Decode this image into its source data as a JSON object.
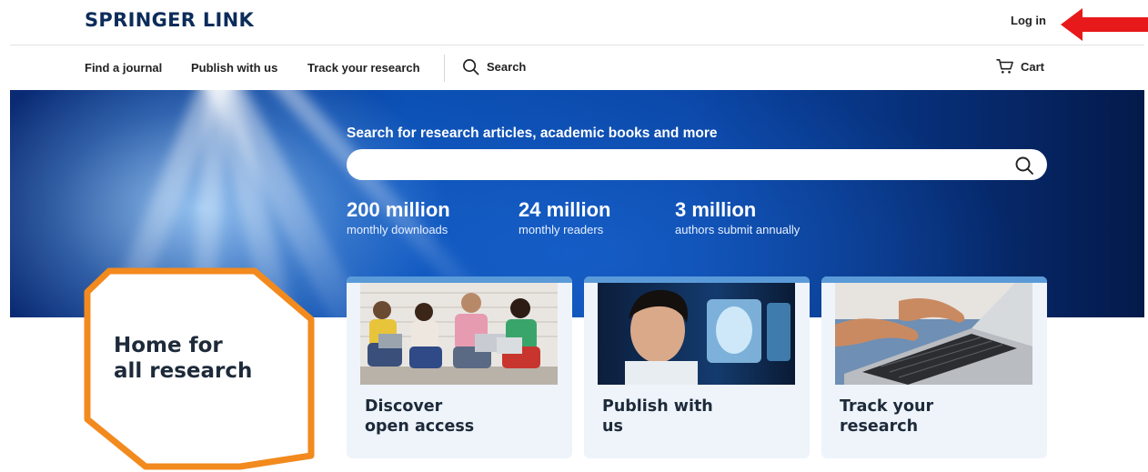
{
  "header": {
    "logo": "SPRINGER LINK",
    "login_label": "Log in"
  },
  "nav": {
    "items": [
      {
        "label": "Find a journal"
      },
      {
        "label": "Publish with us"
      },
      {
        "label": "Track your research"
      }
    ],
    "search_label": "Search",
    "cart_label": "Cart"
  },
  "hero": {
    "heading": "Search for research articles, academic books and more",
    "search_value": "",
    "stats": [
      {
        "number": "200 million",
        "label": "monthly downloads"
      },
      {
        "number": "24 million",
        "label": "monthly readers"
      },
      {
        "number": "3 million",
        "label": "authors submit annually"
      }
    ]
  },
  "home": {
    "line1": "Home for",
    "line2": "all research"
  },
  "cards": [
    {
      "line1": "Discover",
      "line2": "open access"
    },
    {
      "line1": "Publish with",
      "line2": "us"
    },
    {
      "line1": "Track your",
      "line2": "research"
    }
  ],
  "colors": {
    "brand_navy": "#0c2c5a",
    "annotation_red": "#e8191a",
    "annotation_orange": "#f28a1e",
    "card_background": "#eef4fa"
  }
}
